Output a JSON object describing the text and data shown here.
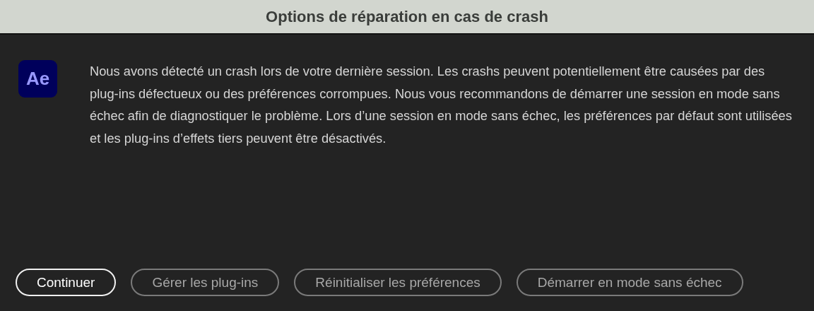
{
  "window": {
    "title": "Options de réparation en cas de crash"
  },
  "app_icon": {
    "label": "Ae"
  },
  "message": "Nous avons détecté un crash lors de votre dernière session. Les crashs peuvent potentiellement être causées par des plug-ins défectueux ou des préférences corrompues. Nous vous recommandons de démarrer une session en mode sans échec afin de diagnostiquer le problème. Lors d’une session en mode sans échec, les préférences par défaut sont utilisées et les plug-ins d’effets tiers peuvent être désactivés.",
  "buttons": [
    {
      "label": "Continuer",
      "primary": true
    },
    {
      "label": "Gérer les plug-ins",
      "primary": false
    },
    {
      "label": "Réinitialiser les préférences",
      "primary": false
    },
    {
      "label": "Démarrer en mode sans échec",
      "primary": false
    }
  ]
}
